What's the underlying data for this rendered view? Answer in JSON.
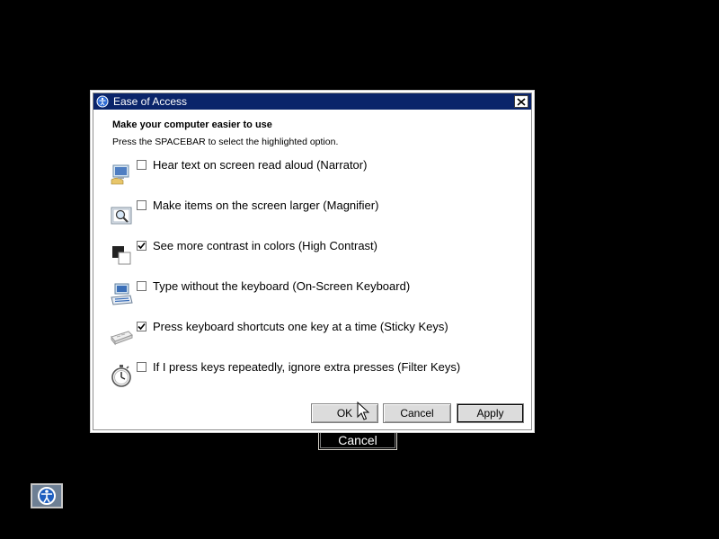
{
  "background": {
    "cancel_label": "Cancel"
  },
  "dialog": {
    "title": "Ease of Access",
    "heading": "Make your computer easier to use",
    "subheading": "Press the SPACEBAR to select the highlighted option.",
    "options": [
      {
        "label": "Hear text on screen read aloud (Narrator)",
        "checked": false,
        "icon": "narrator-icon"
      },
      {
        "label": "Make items on the screen larger (Magnifier)",
        "checked": false,
        "icon": "magnifier-icon"
      },
      {
        "label": "See more contrast in colors (High Contrast)",
        "checked": true,
        "icon": "high-contrast-icon"
      },
      {
        "label": "Type without the keyboard (On-Screen Keyboard)",
        "checked": false,
        "icon": "keyboard-icon"
      },
      {
        "label": "Press keyboard shortcuts one key at a time (Sticky Keys)",
        "checked": true,
        "icon": "sticky-keys-icon"
      },
      {
        "label": "If I press keys repeatedly, ignore extra presses (Filter Keys)",
        "checked": false,
        "icon": "filter-keys-icon"
      }
    ],
    "buttons": {
      "ok": "OK",
      "cancel": "Cancel",
      "apply": "Apply"
    }
  },
  "colors": {
    "titlebar": "#0a246a",
    "desktop": "#000000"
  }
}
